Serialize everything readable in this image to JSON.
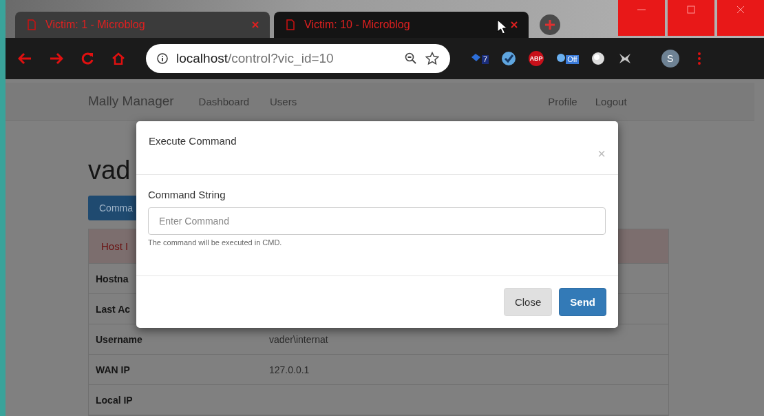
{
  "browser": {
    "tabs": [
      {
        "title": "Victim: 1 - Microblog",
        "selected": false
      },
      {
        "title": "Victim: 10 - Microblog",
        "selected": true
      }
    ],
    "address": {
      "host": "localhost",
      "path": "/control?vic_id=10"
    },
    "extensions": [
      {
        "kind": "badge",
        "badge": "7"
      },
      {
        "kind": "check"
      },
      {
        "kind": "label",
        "label": "ABP"
      },
      {
        "kind": "badge-off",
        "badge": "Off"
      },
      {
        "kind": "ball"
      },
      {
        "kind": "cross"
      }
    ],
    "profile": {
      "initial": "S"
    }
  },
  "navbar": {
    "brand": "Mally Manager",
    "left_links": [
      "Dashboard",
      "Users"
    ],
    "right_links": [
      "Profile",
      "Logout"
    ]
  },
  "page": {
    "heading": "vad",
    "command_button": "Comma",
    "panel_title": "Host I",
    "rows": [
      {
        "label": "Hostna"
      },
      {
        "label": "Last Ac"
      },
      {
        "label": "Username",
        "value": "vader\\internat"
      },
      {
        "label": "WAN IP",
        "value": "127.0.0.1"
      },
      {
        "label": "Local IP"
      }
    ]
  },
  "modal": {
    "title": "Execute Command",
    "close": "×",
    "field_label": "Command String",
    "placeholder": "Enter Command",
    "help": "The command will be executed in CMD.",
    "buttons": [
      {
        "label": "Close",
        "kind": "default"
      },
      {
        "label": "Send",
        "kind": "primary"
      }
    ]
  }
}
